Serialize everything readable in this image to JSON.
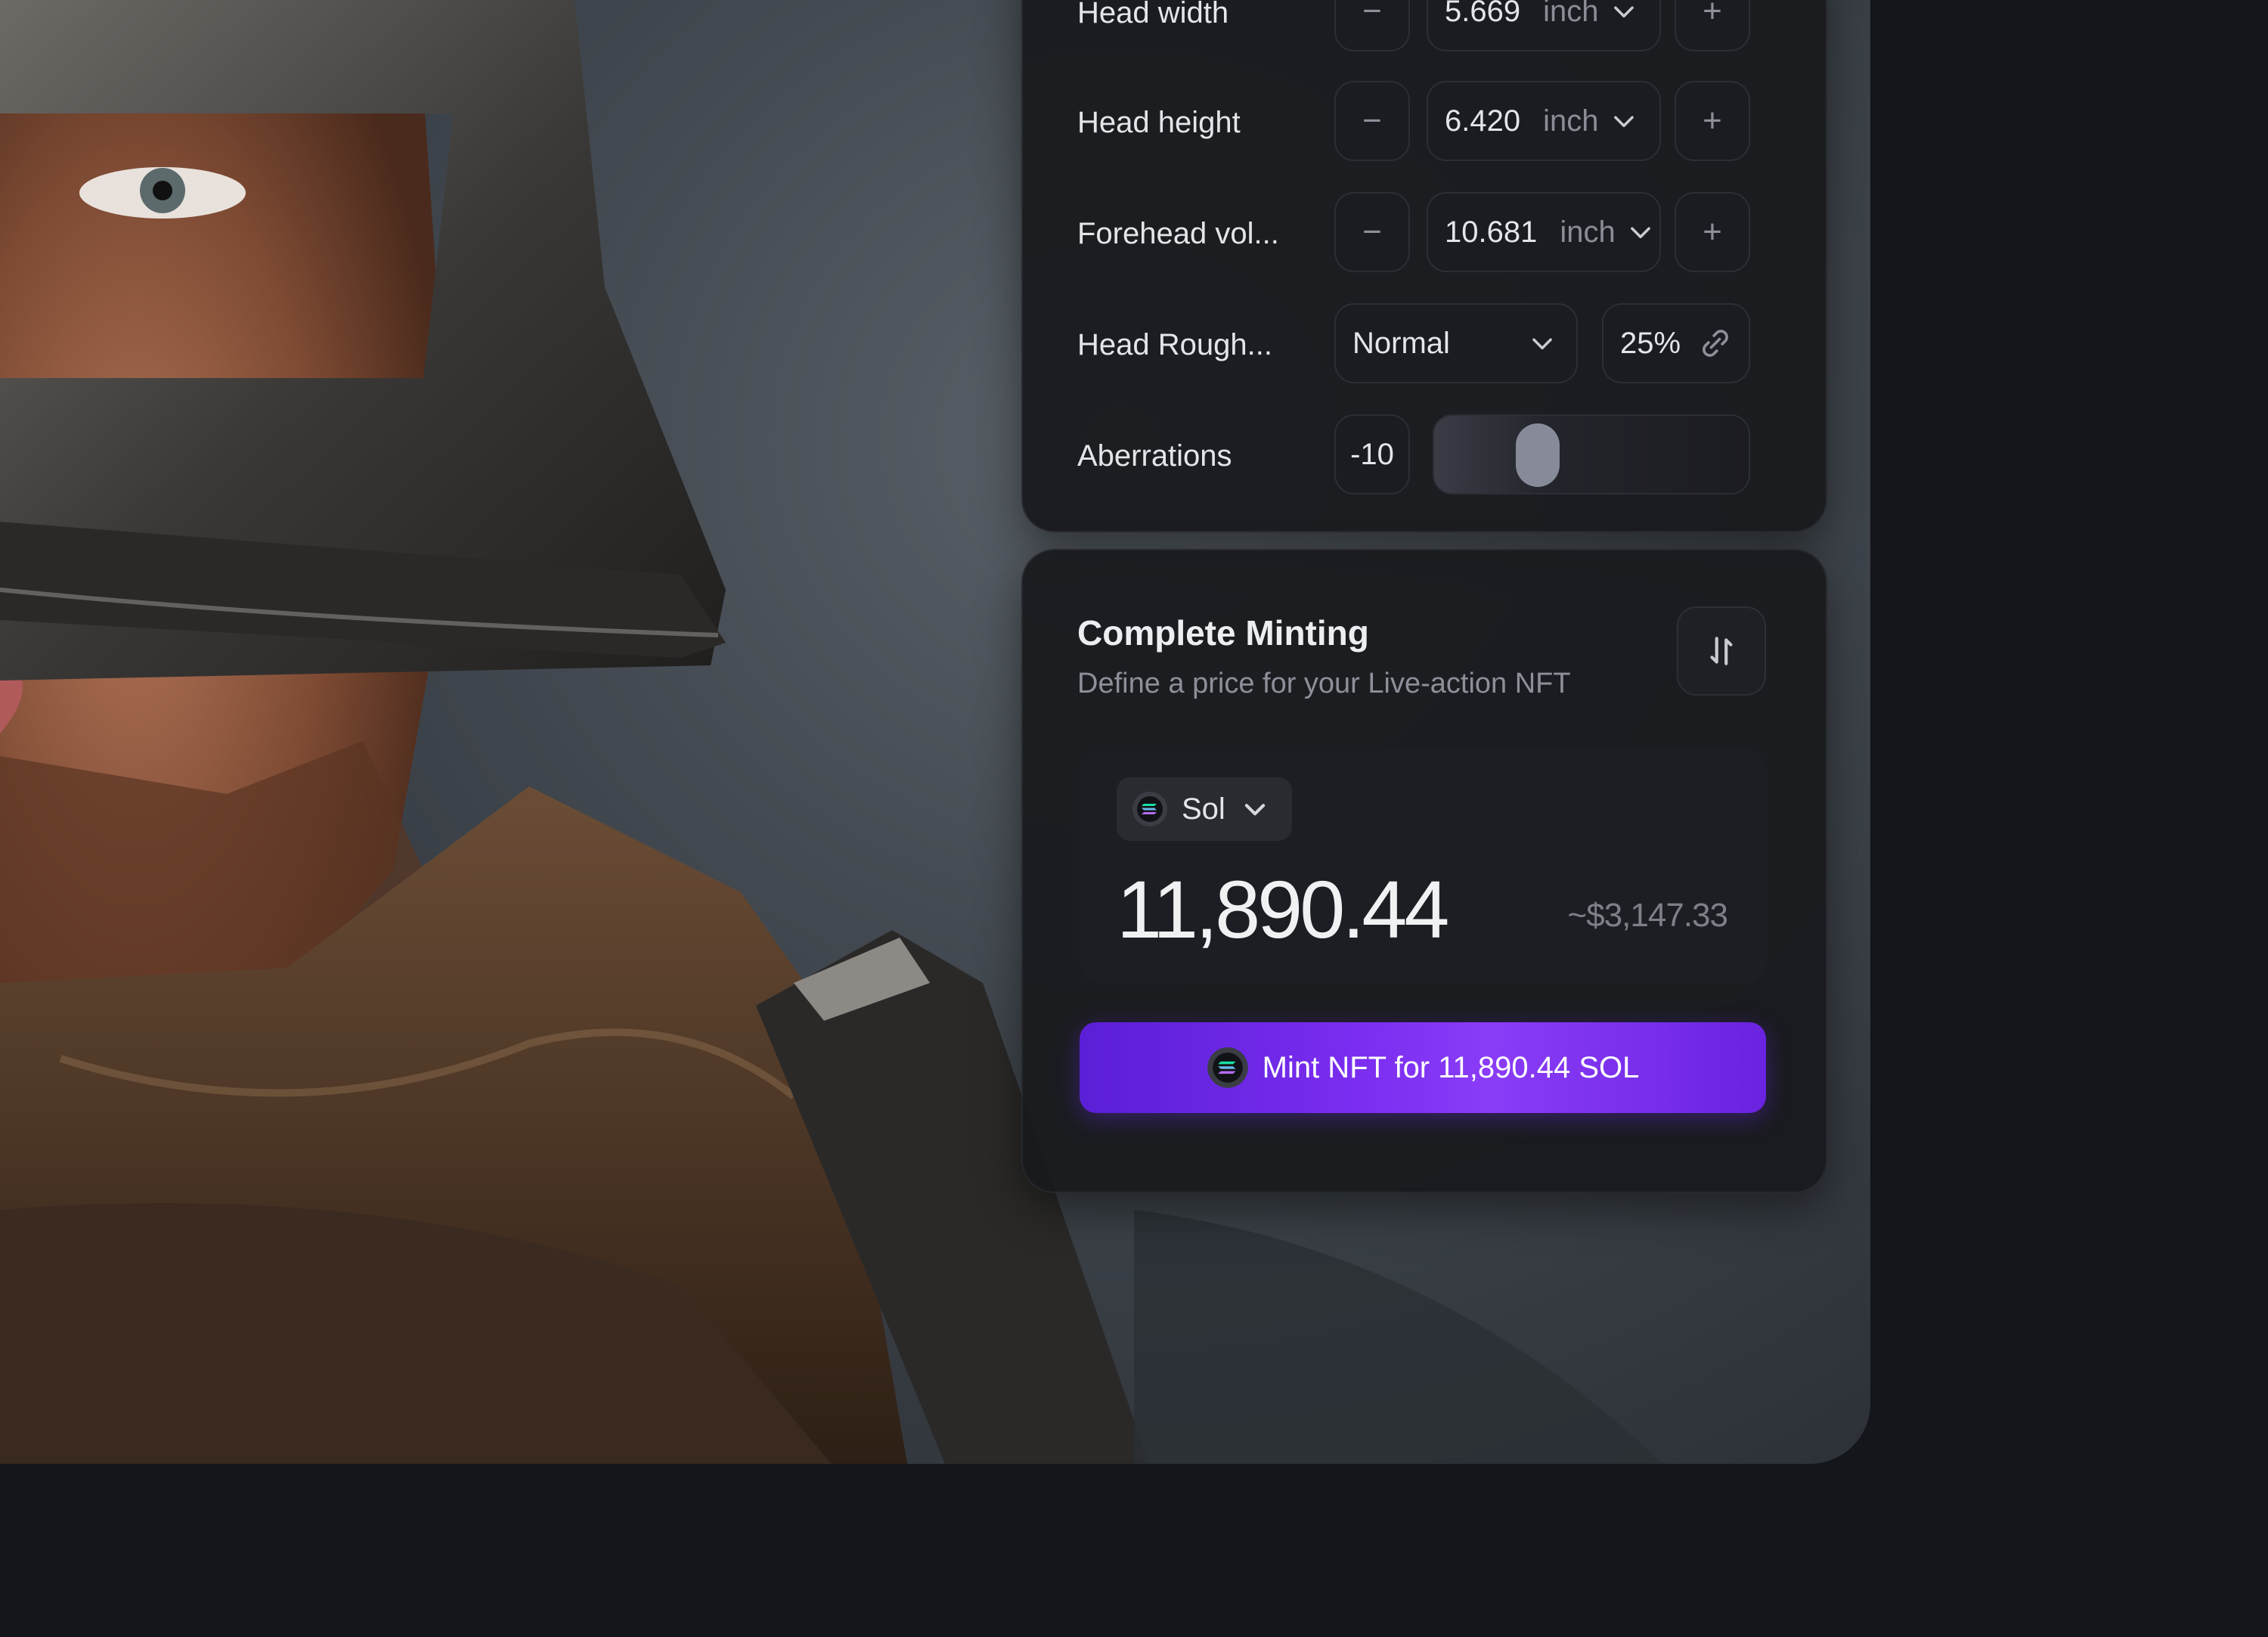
{
  "params": [
    {
      "label": "Head width",
      "value": "5.669",
      "unit": "inch"
    },
    {
      "label": "Head height",
      "value": "6.420",
      "unit": "inch"
    },
    {
      "label": "Forehead vol...",
      "value": "10.681",
      "unit": "inch"
    }
  ],
  "roughness": {
    "label": "Head Rough...",
    "select_value": "Normal",
    "percent": "25%"
  },
  "aberrations": {
    "label": "Aberrations",
    "value": "-10",
    "slider_level": 0.2
  },
  "mint": {
    "title": "Complete Minting",
    "subtitle": "Define a price for your Live-action NFT",
    "token": "Sol",
    "amount": "11,890.44",
    "fiat": "~$3,147.33",
    "button_label": "Mint NFT for 11,890.44 SOL"
  },
  "icons": {
    "minus": "minus-icon",
    "plus": "plus-icon",
    "chevron": "chevron-down-icon",
    "link": "link-icon",
    "swap": "swap-vertical-icon",
    "token": "solana-icon"
  },
  "colors": {
    "accent": "#7a2df0",
    "panel": "#18191e",
    "page": "#14161b"
  }
}
